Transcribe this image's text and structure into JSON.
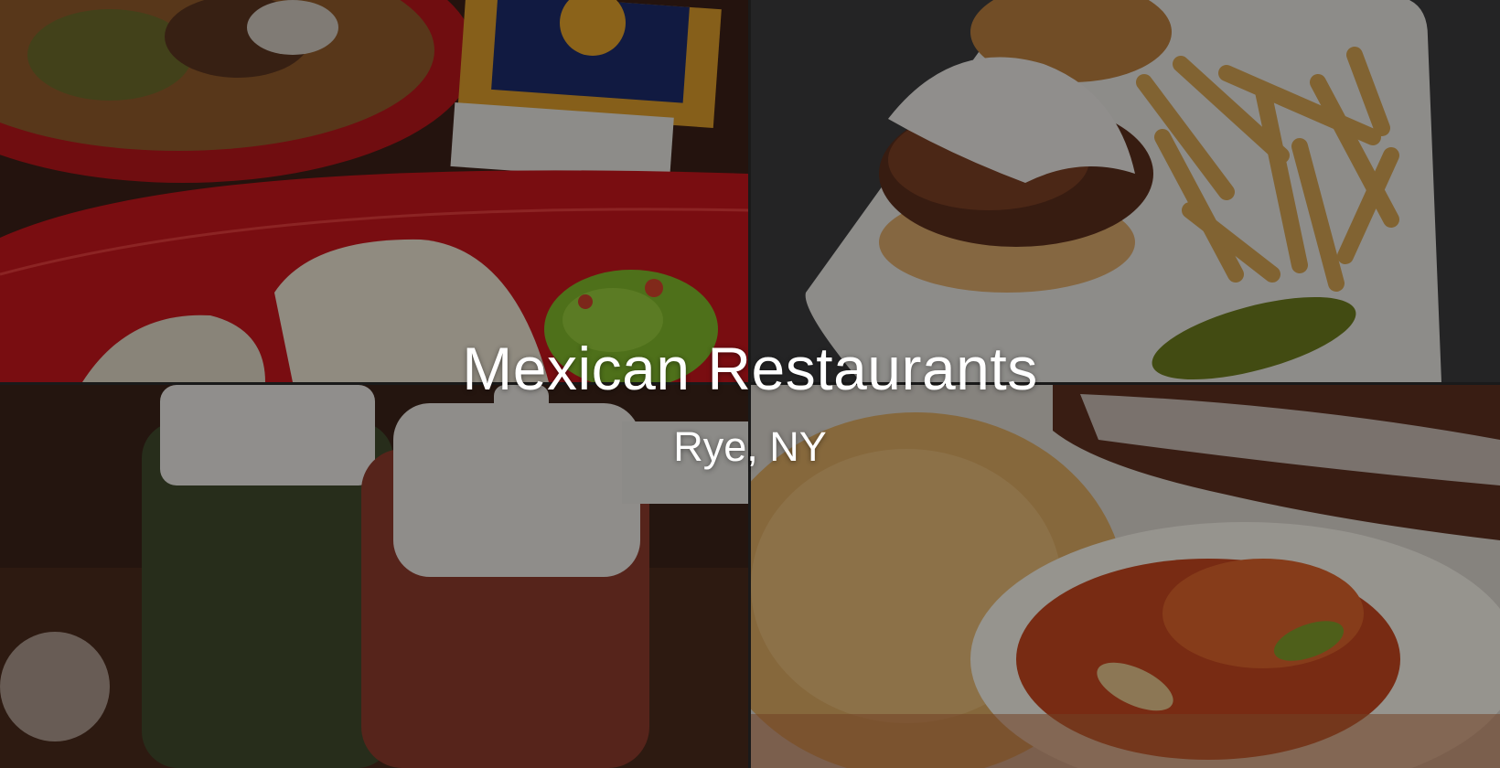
{
  "title": "Mexican Restaurants",
  "subtitle": "Rye, NY",
  "photos": {
    "top_left": "enchiladas-burrito-guacamole-and-beer-photo",
    "top_right": "pulled-pork-sandwich-fries-pickle-photo",
    "bottom_left": "salsa-squeeze-bottles-photo",
    "bottom_right": "rice-beans-huevos-rancheros-photo"
  },
  "colors": {
    "plate_red": "#c4161c",
    "table_dark": "#3a2a22",
    "plate_white": "#e9e6e0",
    "overlay": "rgba(0,0,0,0.38)"
  }
}
